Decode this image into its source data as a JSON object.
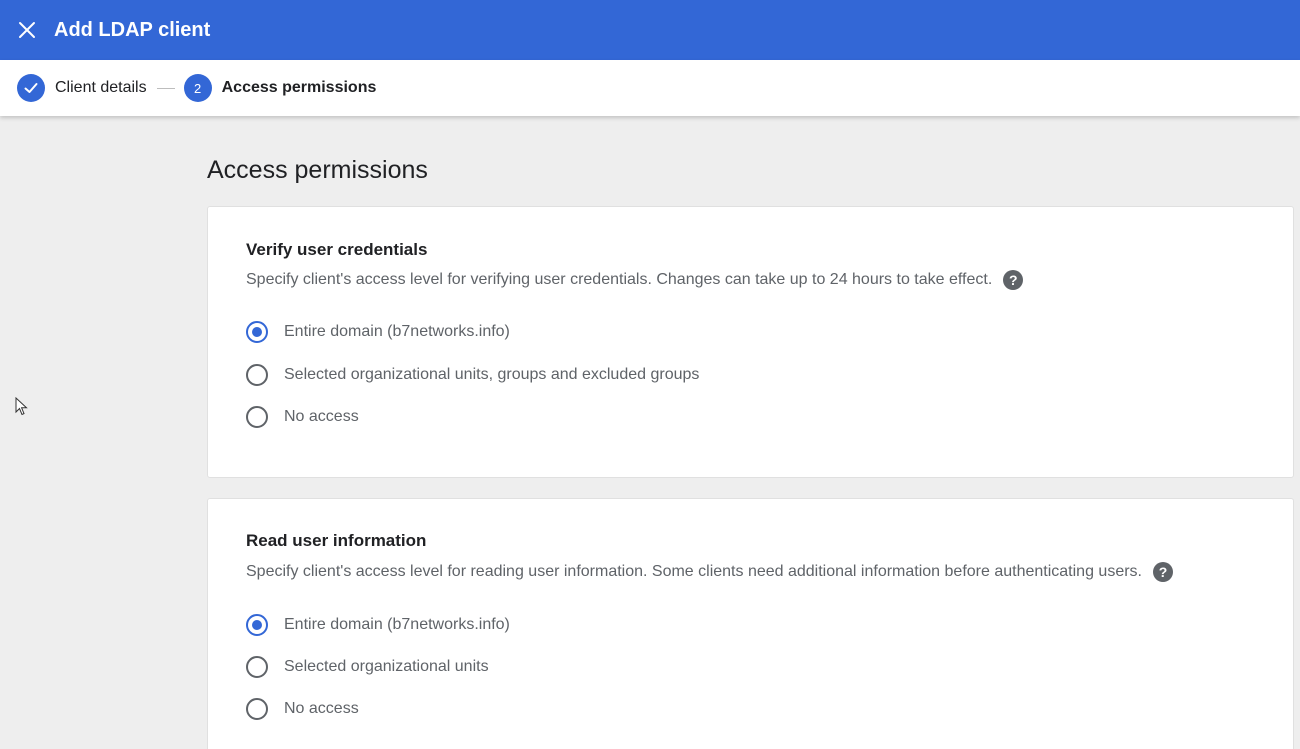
{
  "header": {
    "title": "Add LDAP client",
    "close_icon": "close-icon"
  },
  "stepper": {
    "steps": [
      {
        "number": "1",
        "label": "Client details",
        "state": "completed",
        "icon": "check-icon"
      },
      {
        "number": "2",
        "label": "Access permissions",
        "state": "active"
      }
    ]
  },
  "main": {
    "page_title": "Access permissions",
    "sections": [
      {
        "title": "Verify user credentials",
        "description": "Specify client's access level for verifying user credentials. Changes can take up to 24 hours to take effect.",
        "help_icon": "?",
        "options": [
          {
            "label": "Entire domain (b7networks.info)",
            "checked": true
          },
          {
            "label": "Selected organizational units, groups and excluded groups",
            "checked": false
          },
          {
            "label": "No access",
            "checked": false
          }
        ]
      },
      {
        "title": "Read user information",
        "description": "Specify client's access level for reading user information. Some clients need additional information before authenticating users.",
        "help_icon": "?",
        "options": [
          {
            "label": "Entire domain (b7networks.info)",
            "checked": true
          },
          {
            "label": "Selected organizational units",
            "checked": false
          },
          {
            "label": "No access",
            "checked": false
          }
        ]
      }
    ]
  },
  "colors": {
    "accent": "#3367d6",
    "background": "#eeeeee",
    "text_secondary": "#5f6368"
  }
}
